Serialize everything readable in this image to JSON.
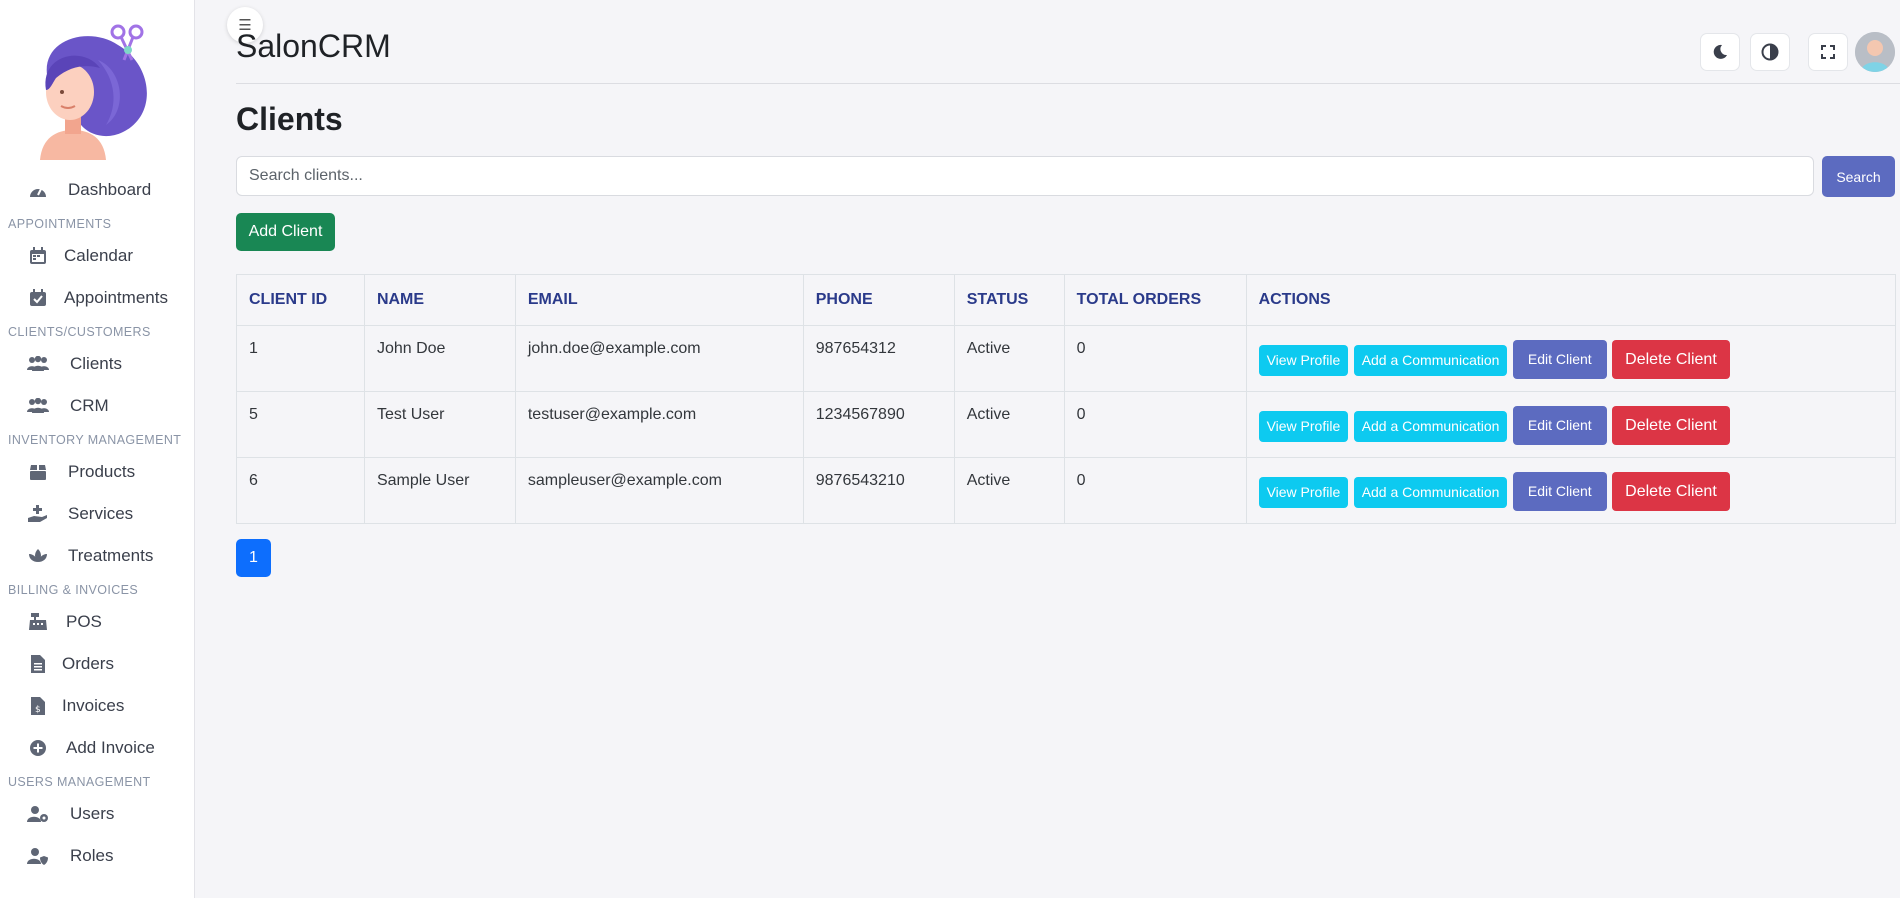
{
  "app": {
    "title": "SalonCRM",
    "brand_color": "#5c6bc0"
  },
  "sidebar": {
    "dashboard": "Dashboard",
    "sections": {
      "appointments": "APPOINTMENTS",
      "clients": "CLIENTS/CUSTOMERS",
      "inventory": "INVENTORY MANAGEMENT",
      "billing": "BILLING & INVOICES",
      "users": "USERS MANAGEMENT"
    },
    "items": {
      "calendar": "Calendar",
      "appointments": "Appointments",
      "clients": "Clients",
      "crm": "CRM",
      "products": "Products",
      "services": "Services",
      "treatments": "Treatments",
      "pos": "POS",
      "orders": "Orders",
      "invoices": "Invoices",
      "add_invoice": "Add Invoice",
      "users": "Users",
      "roles": "Roles"
    }
  },
  "topbar": {
    "toggle_icon": "☰",
    "icons": [
      "moon-icon",
      "contrast-icon",
      "fullscreen-icon",
      "user-avatar"
    ]
  },
  "main": {
    "page_title": "Clients",
    "search_placeholder": "Search clients...",
    "search_button": "Search",
    "add_client_button": "Add Client",
    "columns": {
      "id": "CLIENT ID",
      "name": "NAME",
      "email": "EMAIL",
      "phone": "PHONE",
      "status": "STATUS",
      "orders": "TOTAL ORDERS",
      "actions": "ACTIONS"
    },
    "rows": [
      {
        "id": "1",
        "name": "John Doe",
        "email": "john.doe@example.com",
        "phone": "987654312",
        "status": "Active",
        "orders": "0"
      },
      {
        "id": "5",
        "name": "Test User",
        "email": "testuser@example.com",
        "phone": "1234567890",
        "status": "Active",
        "orders": "0"
      },
      {
        "id": "6",
        "name": "Sample User",
        "email": "sampleuser@example.com",
        "phone": "9876543210",
        "status": "Active",
        "orders": "0"
      }
    ],
    "action_labels": {
      "view": "View Profile",
      "comm": "Add a Communication",
      "edit": "Edit Client",
      "delete": "Delete Client"
    },
    "pagination": {
      "current": "1"
    }
  }
}
